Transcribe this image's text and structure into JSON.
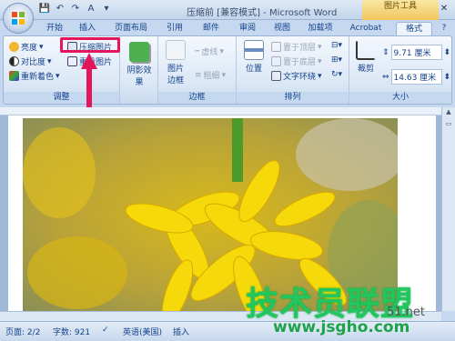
{
  "window": {
    "title": "压缩前 [兼容模式] - Microsoft Word",
    "contextual_tab": "图片工具"
  },
  "tabs": [
    "开始",
    "插入",
    "页面布局",
    "引用",
    "邮件",
    "审阅",
    "视图",
    "加载项",
    "Acrobat",
    "格式"
  ],
  "ribbon": {
    "adjust": {
      "label": "调整",
      "brightness": "亮度",
      "contrast": "对比度",
      "recolor": "重新着色",
      "compress": "压缩图片",
      "reset": "重设图片"
    },
    "styles": {
      "shadow_effect": "阴影效果"
    },
    "border": {
      "label": "边框",
      "picture_border": "图片\n边框",
      "dashes": "虚线",
      "weight": "粗细"
    },
    "arrange": {
      "label": "排列",
      "position": "位置",
      "bring_front": "置于顶层",
      "send_back": "置于底层",
      "text_wrap": "文字环绕"
    },
    "size": {
      "label": "大小",
      "crop": "裁剪",
      "height": "9.71 厘米",
      "width": "14.63 厘米"
    }
  },
  "statusbar": {
    "page": "页面: 2/2",
    "words": "字数: 921",
    "language": "英语(美国)",
    "mode": "插入"
  },
  "watermark": {
    "logo": "技术员联盟",
    "url": "www.jsgho.com",
    "corner": "51.net"
  },
  "colors": {
    "highlight": "#e3165b",
    "accent": "#15428b",
    "flower": "#f5d90a"
  }
}
